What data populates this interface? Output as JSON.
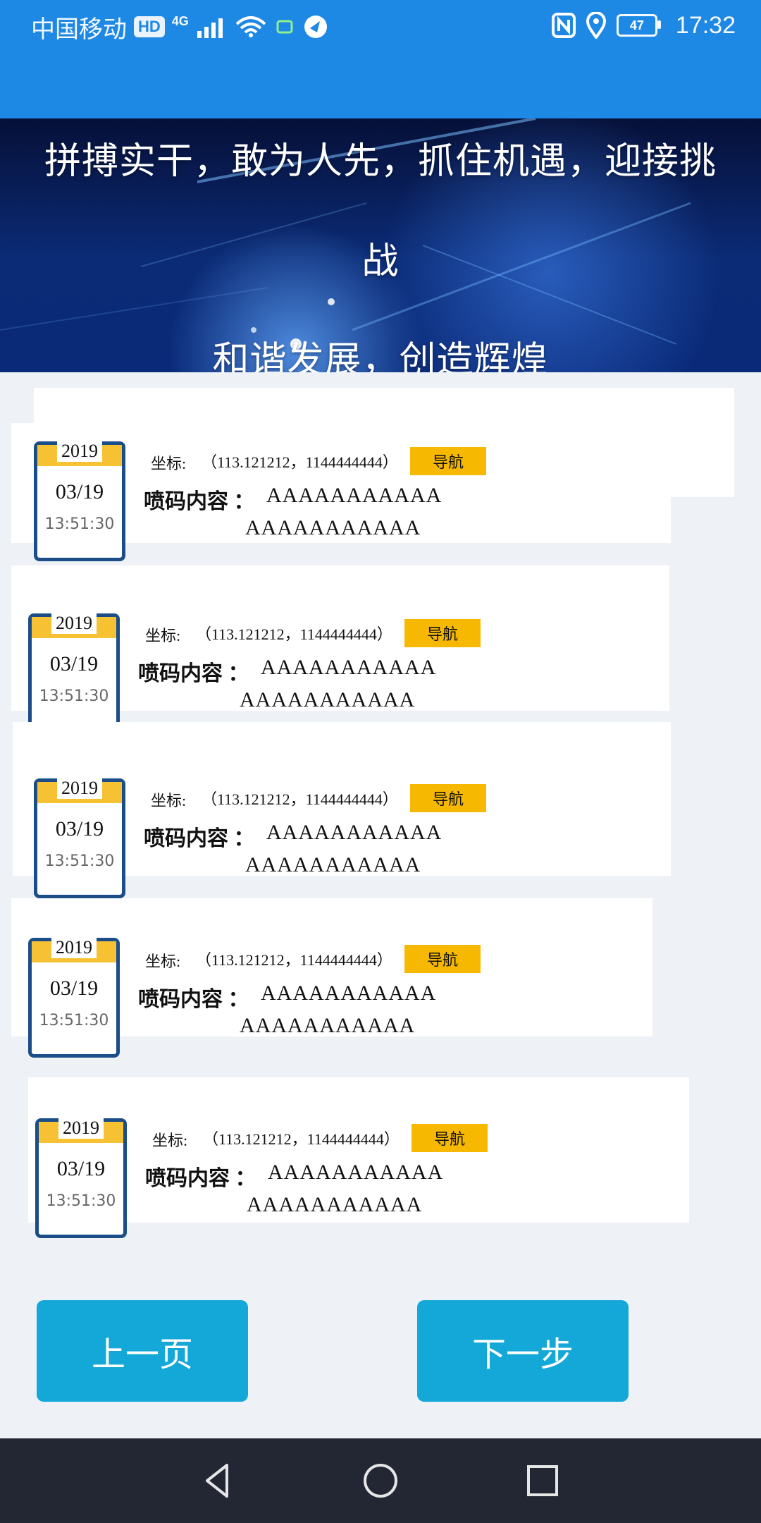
{
  "status_bar": {
    "carrier": "中国移动",
    "hd": "HD",
    "network": "4G",
    "battery": "47",
    "time": "17:32"
  },
  "banner": {
    "line1": "拼搏实干，敢为人先，抓住机遇，迎接挑",
    "line2": "战",
    "line3": "和谐发展，创造辉煌"
  },
  "records": [
    {
      "year": "2019",
      "date": "03/19",
      "time": "13:51:30",
      "coord_label": "坐标:",
      "coord_value": "（113.121212，1144444444）",
      "nav_label": "导航",
      "content_label": "喷码内容 ：",
      "content_line1": "AAAAAAAAAAA",
      "content_line2": "AAAAAAAAAAA"
    },
    {
      "year": "2019",
      "date": "03/19",
      "time": "13:51:30",
      "coord_label": "坐标:",
      "coord_value": "（113.121212，1144444444）",
      "nav_label": "导航",
      "content_label": "喷码内容 ：",
      "content_line1": "AAAAAAAAAAA",
      "content_line2": "AAAAAAAAAAA"
    },
    {
      "year": "2019",
      "date": "03/19",
      "time": "13:51:30",
      "coord_label": "坐标:",
      "coord_value": "（113.121212，1144444444）",
      "nav_label": "导航",
      "content_label": "喷码内容 ：",
      "content_line1": "AAAAAAAAAAA",
      "content_line2": "AAAAAAAAAAA"
    },
    {
      "year": "2019",
      "date": "03/19",
      "time": "13:51:30",
      "coord_label": "坐标:",
      "coord_value": "（113.121212，1144444444）",
      "nav_label": "导航",
      "content_label": "喷码内容 ：",
      "content_line1": "AAAAAAAAAAA",
      "content_line2": "AAAAAAAAAAA"
    },
    {
      "year": "2019",
      "date": "03/19",
      "time": "13:51:30",
      "coord_label": "坐标:",
      "coord_value": "（113.121212，1144444444）",
      "nav_label": "导航",
      "content_label": "喷码内容 ：",
      "content_line1": "AAAAAAAAAAA",
      "content_line2": "AAAAAAAAAAA"
    }
  ],
  "buttons": {
    "prev": "上一页",
    "next": "下一步"
  },
  "nav_icons": [
    "back-icon",
    "home-icon",
    "recents-icon"
  ]
}
